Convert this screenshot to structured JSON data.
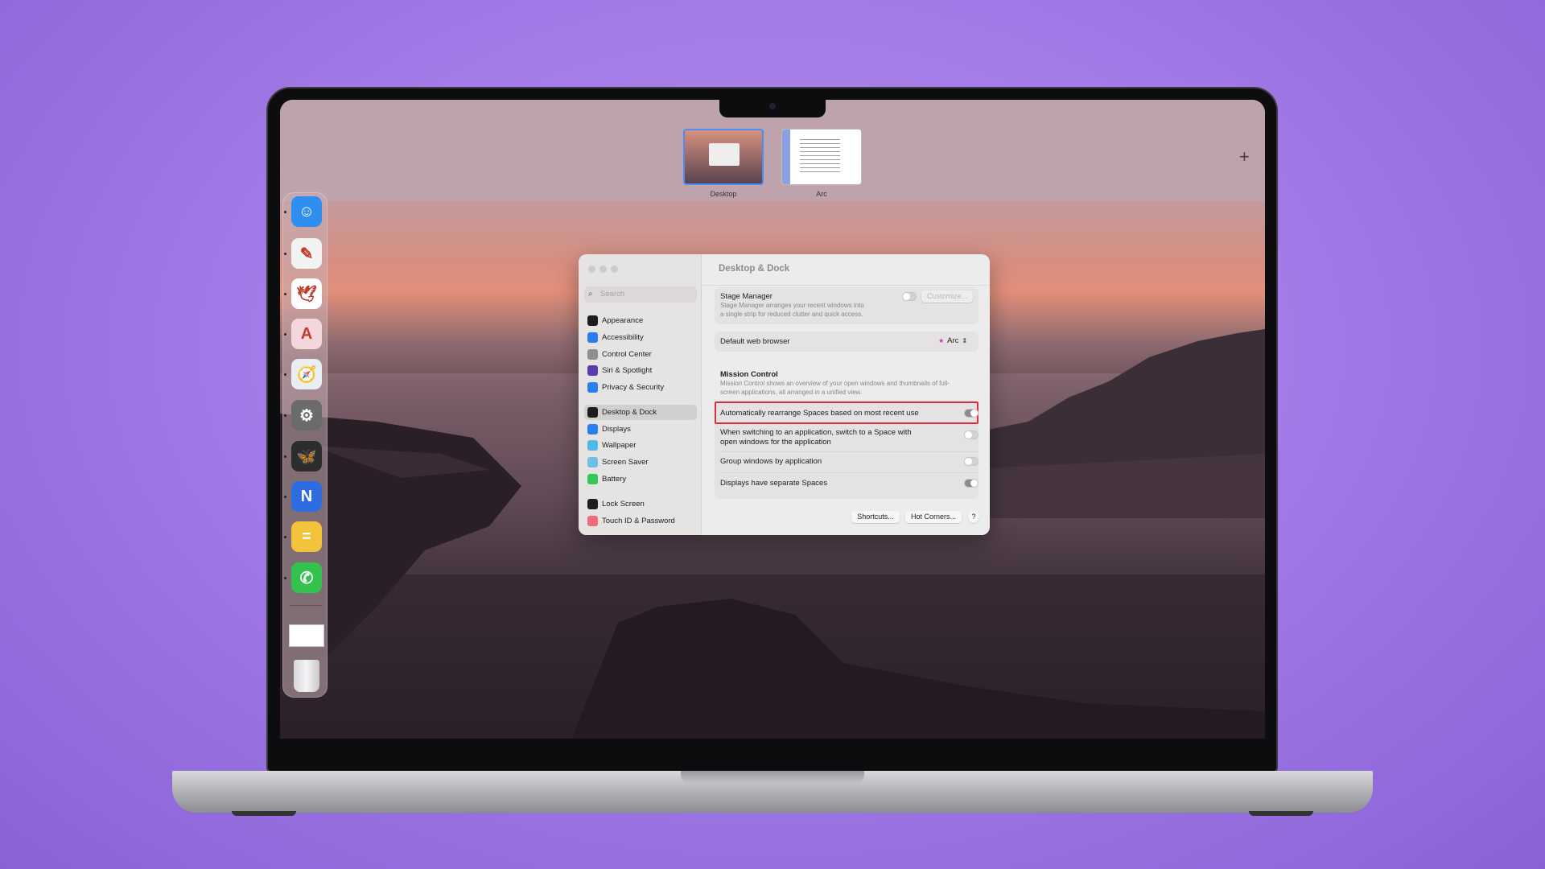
{
  "spaces": {
    "items": [
      {
        "label": "Desktop"
      },
      {
        "label": "Arc"
      }
    ],
    "add_icon": "plus-icon"
  },
  "dock": {
    "apps": [
      {
        "name": "Finder",
        "icon": "finder-icon",
        "color": "#2f8ff0",
        "glyph": "☺"
      },
      {
        "name": "Pixelmator",
        "icon": "pixelmator-icon",
        "color": "#f2f2f2",
        "glyph": "✎"
      },
      {
        "name": "Mail Bird",
        "icon": "bird-icon",
        "color": "#ffffff",
        "glyph": "🕊"
      },
      {
        "name": "Arc",
        "icon": "arc-icon",
        "color": "#f4d7dc",
        "glyph": "A"
      },
      {
        "name": "Safari",
        "icon": "safari-icon",
        "color": "#e9eef5",
        "glyph": "🧭"
      },
      {
        "name": "System Settings",
        "icon": "gear-icon",
        "color": "#6b6b6e",
        "glyph": "⚙"
      },
      {
        "name": "Tes",
        "icon": "butterfly-icon",
        "color": "#2d2d2d",
        "glyph": "🦋"
      },
      {
        "name": "Nova",
        "icon": "n-icon",
        "color": "#2d6de0",
        "glyph": "N"
      },
      {
        "name": "Soulver",
        "icon": "calculator-icon",
        "color": "#f4c33c",
        "glyph": "="
      },
      {
        "name": "WhatsApp",
        "icon": "whatsapp-icon",
        "color": "#33c24d",
        "glyph": "✆"
      }
    ]
  },
  "settings": {
    "search_placeholder": "Search",
    "title": "Desktop & Dock",
    "sidebar": [
      {
        "label": "Appearance",
        "icon": "appearance-icon",
        "color": "#1d1d1f"
      },
      {
        "label": "Accessibility",
        "icon": "accessibility-icon",
        "color": "#2a7ff0"
      },
      {
        "label": "Control Center",
        "icon": "control-center-icon",
        "color": "#8e8e93"
      },
      {
        "label": "Siri & Spotlight",
        "icon": "siri-icon",
        "color": "#5a3bb0"
      },
      {
        "label": "Privacy & Security",
        "icon": "hand-icon",
        "color": "#2a7ff0"
      },
      {
        "label": "Desktop & Dock",
        "icon": "dock-icon",
        "color": "#1d1d1f"
      },
      {
        "label": "Displays",
        "icon": "displays-icon",
        "color": "#2a7ff0"
      },
      {
        "label": "Wallpaper",
        "icon": "wallpaper-icon",
        "color": "#4fb8e8"
      },
      {
        "label": "Screen Saver",
        "icon": "screensaver-icon",
        "color": "#6cc0e6"
      },
      {
        "label": "Battery",
        "icon": "battery-icon",
        "color": "#34c759"
      },
      {
        "label": "Lock Screen",
        "icon": "lock-icon",
        "color": "#1d1d1f"
      },
      {
        "label": "Touch ID & Password",
        "icon": "fingerprint-icon",
        "color": "#ee6b7a"
      }
    ],
    "stage_manager": {
      "label": "Stage Manager",
      "desc": "Stage Manager arranges your recent windows into a single strip for reduced clutter and quick access.",
      "customize": "Customize...",
      "enabled": false
    },
    "browser": {
      "label": "Default web browser",
      "value": "Arc"
    },
    "mission_control": {
      "heading": "Mission Control",
      "desc": "Mission Control shows an overview of your open windows and thumbnails of full-screen applications, all arranged in a unified view.",
      "rows": [
        {
          "label": "Automatically rearrange Spaces based on most recent use",
          "enabled": true
        },
        {
          "label": "When switching to an application, switch to a Space with open windows for the application",
          "enabled": false
        },
        {
          "label": "Group windows by application",
          "enabled": false
        },
        {
          "label": "Displays have separate Spaces",
          "enabled": true
        }
      ]
    },
    "buttons": {
      "shortcuts": "Shortcuts...",
      "hot_corners": "Hot Corners...",
      "help": "?"
    }
  }
}
